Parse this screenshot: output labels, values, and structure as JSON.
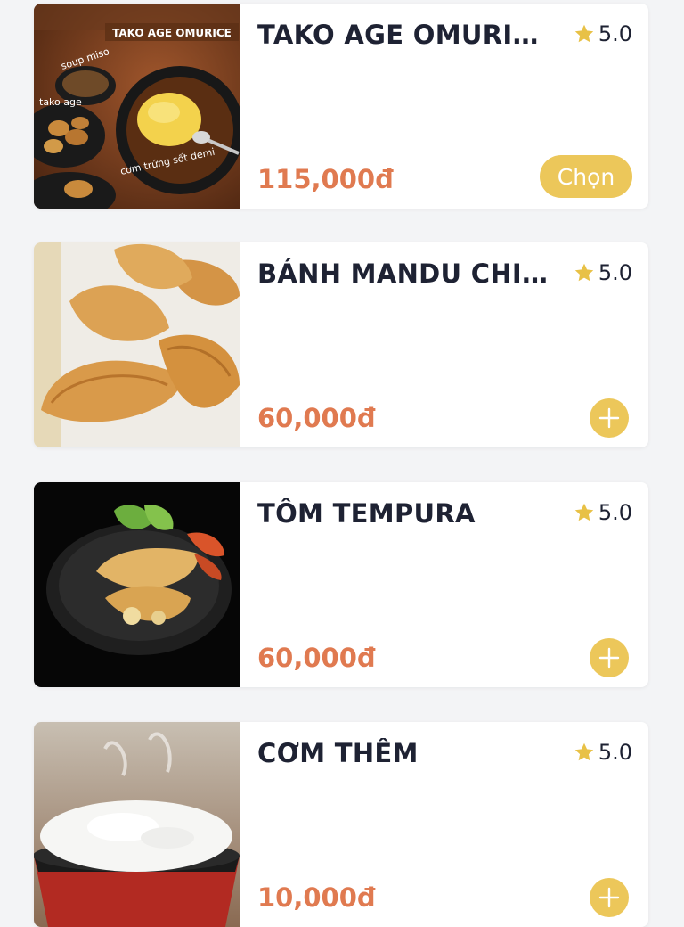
{
  "colors": {
    "accent": "#ecc75a",
    "price": "#e07a50",
    "title": "#1e2233",
    "card_bg": "#ffffff",
    "page_bg": "#f3f4f6"
  },
  "items": [
    {
      "name": "TAKO AGE OMURICE…",
      "rating": "5.0",
      "price": "115,000đ",
      "action": "Chọn",
      "image_text": {
        "title": "TAKO AGE OMURICE",
        "soup": "soup miso",
        "tako": "tako age",
        "rice": "cơm trứng sốt demi"
      }
    },
    {
      "name": "BÁNH MANDU CHIÊN",
      "rating": "5.0",
      "price": "60,000đ",
      "action_icon": "plus-icon"
    },
    {
      "name": "TÔM TEMPURA",
      "rating": "5.0",
      "price": "60,000đ",
      "action_icon": "plus-icon"
    },
    {
      "name": "CƠM THÊM",
      "rating": "5.0",
      "price": "10,000đ",
      "action_icon": "plus-icon"
    }
  ]
}
